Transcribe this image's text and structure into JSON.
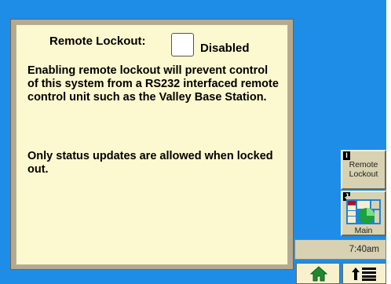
{
  "dialog": {
    "lockout_label": "Remote Lockout:",
    "status_label": "Disabled",
    "description": "Enabling remote lockout will prevent control of this system from a RS232 interfaced remote control unit such as the Valley Base Station.",
    "note": "Only status updates are allowed when locked out."
  },
  "softkeys": [
    {
      "letter": "I",
      "label": "Remote Lockout"
    },
    {
      "letter": "J",
      "label": "Main",
      "icon": "main-screen-thumbnail"
    }
  ],
  "status_bar": {
    "time": "7:40am"
  },
  "nav": {
    "home_icon": "home-icon",
    "up_menu_icon": "up-arrow-menu-icon"
  }
}
